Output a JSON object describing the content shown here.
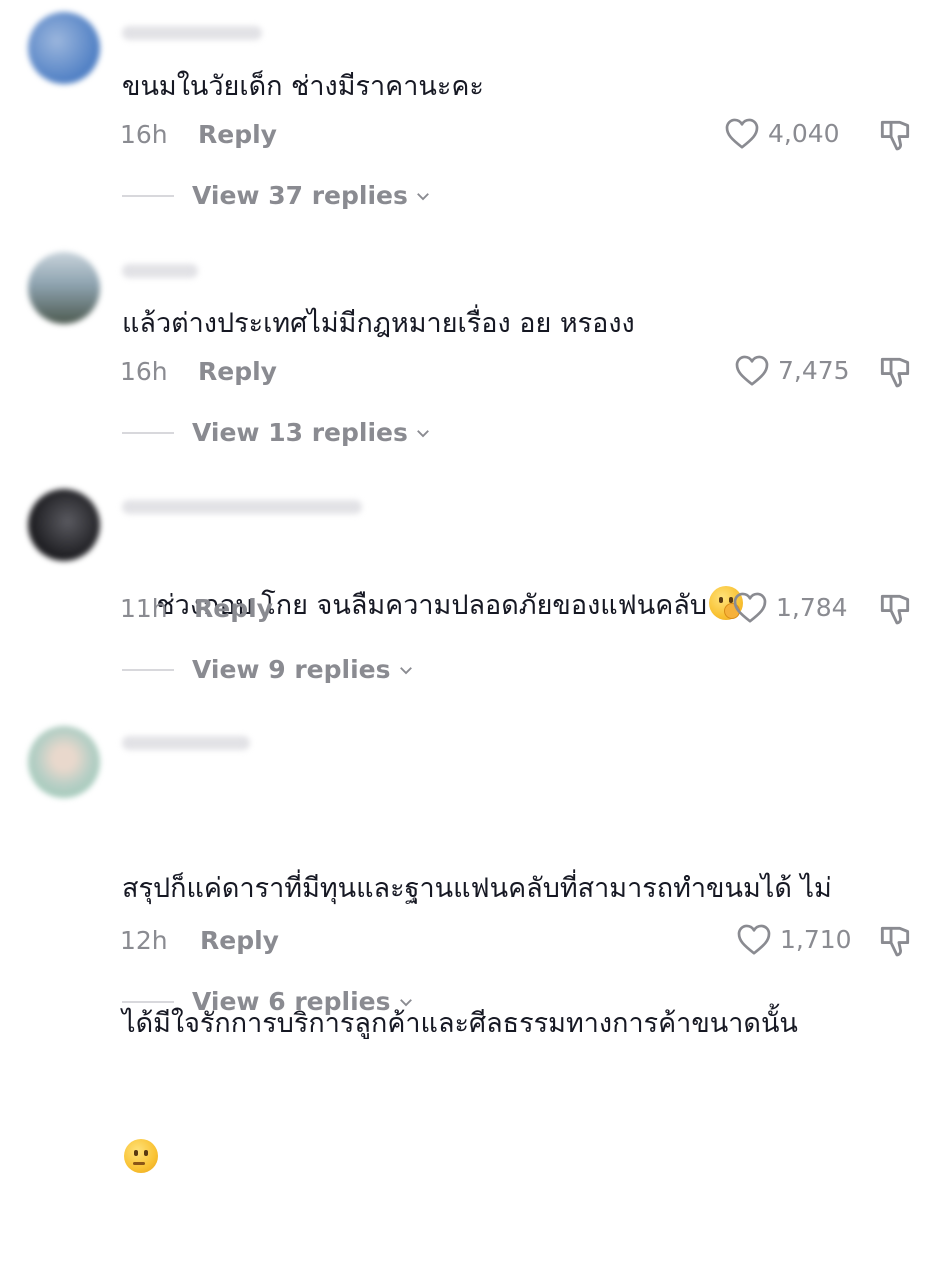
{
  "comments": [
    {
      "text": "ขนมในวัยเด็ก ช่างมีราคานะคะ",
      "time": "16h",
      "reply": "Reply",
      "likes": "4,040",
      "view_replies": "View 37 replies",
      "avatar_colors": [
        "#4f7fc4",
        "#9bb6dd"
      ]
    },
    {
      "text": "แล้วต่างประเทศไม่มีกฎหมายเรื่อง อย หรองง",
      "time": "16h",
      "reply": "Reply",
      "likes": "7,475",
      "view_replies": "View 13 replies",
      "avatar_colors": [
        "#6f8a9a",
        "#c8d3db"
      ]
    },
    {
      "text": "ช่วงกอบ โกย จนลืมความปลอดภัยของแฟนคลับ",
      "emoji": "face-with-hand-over-mouth",
      "time": "11h",
      "reply": "Reply",
      "likes": "1,784",
      "view_replies": "View 9 replies",
      "avatar_colors": [
        "#1e1e22",
        "#5a5a60"
      ]
    },
    {
      "text_line1": "สรุปก็แค่ดาราที่มีทุนและฐานแฟนคลับที่สามารถทำขนมได้ ไม่",
      "text_line2": "ได้มีใจรักการบริการลูกค้าและศีลธรรมทางการค้าขนาดนั้น",
      "emoji": "thinking-face",
      "time": "12h",
      "reply": "Reply",
      "likes": "1,710",
      "view_replies": "View 6 replies",
      "avatar_colors": [
        "#9ec9b8",
        "#e9d8cc"
      ]
    }
  ],
  "icons": {
    "like": "heart-outline-icon",
    "dislike": "thumbs-down-icon",
    "expand": "chevron-down-icon"
  }
}
